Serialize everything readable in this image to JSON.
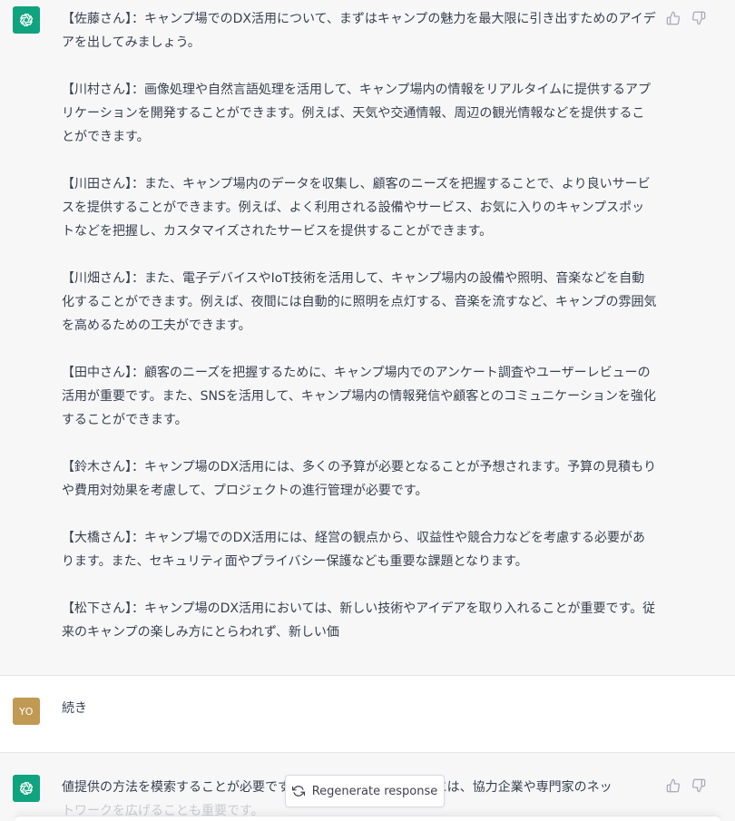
{
  "turns": [
    {
      "role": "assistant",
      "paragraphs": [
        "【佐藤さん】：キャンプ場でのDX活用について、まずはキャンプの魅力を最大限に引き出すためのアイデアを出してみましょう。",
        "【川村さん】：画像処理や自然言語処理を活用して、キャンプ場内の情報をリアルタイムに提供するアプリケーションを開発することができます。例えば、天気や交通情報、周辺の観光情報などを提供することができます。",
        "【川田さん】：また、キャンプ場内のデータを収集し、顧客のニーズを把握することで、より良いサービスを提供することができます。例えば、よく利用される設備やサービス、お気に入りのキャンプスポットなどを把握し、カスタマイズされたサービスを提供することができます。",
        "【川畑さん】：また、電子デバイスやIoT技術を活用して、キャンプ場内の設備や照明、音楽などを自動化することができます。例えば、夜間には自動的に照明を点灯する、音楽を流すなど、キャンプの雰囲気を高めるための工夫ができます。",
        "【田中さん】：顧客のニーズを把握するために、キャンプ場内でのアンケート調査やユーザーレビューの活用が重要です。また、SNSを活用して、キャンプ場内の情報発信や顧客とのコミュニケーションを強化することができます。",
        "【鈴木さん】：キャンプ場のDX活用には、多くの予算が必要となることが予想されます。予算の見積もりや費用対効果を考慮して、プロジェクトの進行管理が必要です。",
        "【大橋さん】：キャンプ場でのDX活用には、経営の観点から、収益性や競合力などを考慮する必要があります。また、セキュリティ面やプライバシー保護なども重要な課題となります。",
        "【松下さん】：キャンプ場のDX活用においては、新しい技術やアイデアを取り入れることが重要です。従来のキャンプの楽しみ方にとらわれず、新しい価"
      ]
    },
    {
      "role": "user",
      "avatar_text": "YO",
      "text": "続き"
    },
    {
      "role": "assistant",
      "visible_text": "値提供の方法を模索することが必要です。",
      "text_tail": "ためには、協力企業や専門家のネッ",
      "faded_text": "トワークを広げることも重要です。"
    }
  ],
  "regenerate": {
    "label": "Regenerate response"
  },
  "colors": {
    "assistant_bg": "#f7f7f8",
    "gpt_avatar": "#10a37f",
    "user_avatar": "#c09a52",
    "text": "#374151"
  }
}
